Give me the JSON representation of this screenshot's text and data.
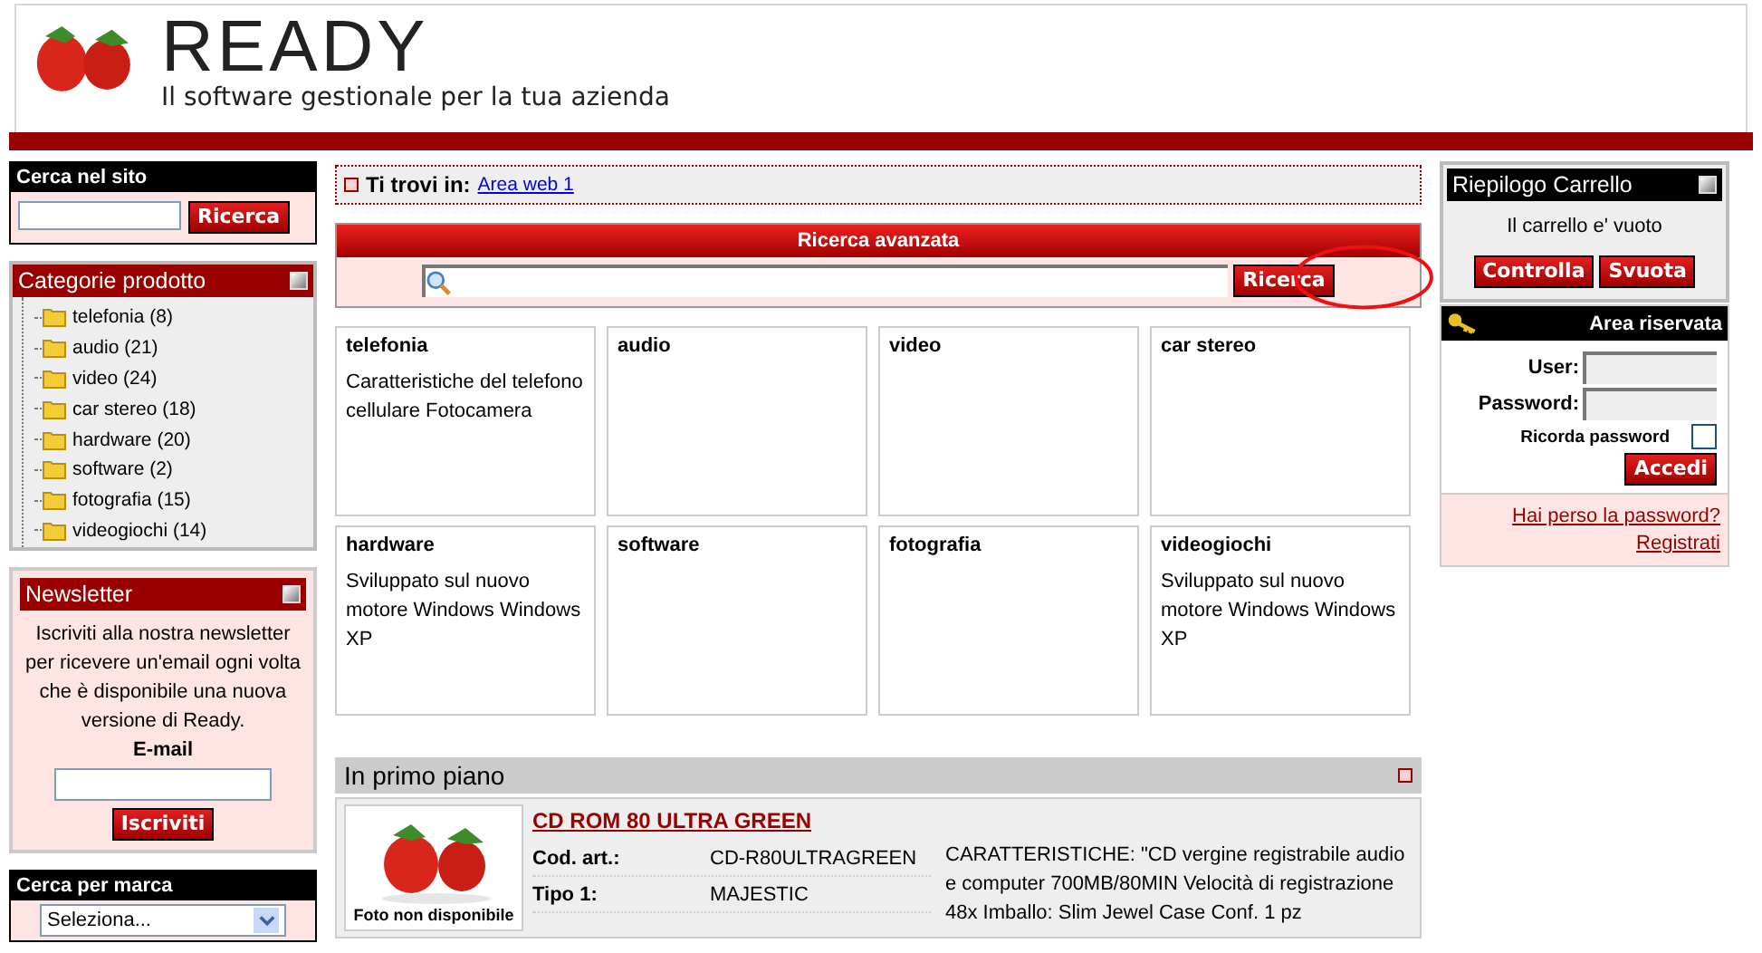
{
  "header": {
    "logo_text": "READY",
    "tagline": "Il software gestionale per la tua azienda"
  },
  "site_search": {
    "title": "Cerca nel sito",
    "button": "Ricerca"
  },
  "categories": {
    "title": "Categorie prodotto",
    "items": [
      {
        "label": "telefonia (8)"
      },
      {
        "label": "audio (21)"
      },
      {
        "label": "video (24)"
      },
      {
        "label": "car stereo (18)"
      },
      {
        "label": "hardware (20)"
      },
      {
        "label": "software (2)"
      },
      {
        "label": "fotografia (15)"
      },
      {
        "label": "videogiochi (14)"
      }
    ]
  },
  "newsletter": {
    "title": "Newsletter",
    "text": "Iscriviti alla nostra newsletter per ricevere un'email ogni volta che è disponibile una nuova versione di Ready.",
    "email_label": "E-mail",
    "button": "Iscriviti"
  },
  "brand_search": {
    "title": "Cerca per marca",
    "select_value": "Seleziona..."
  },
  "breadcrumb": {
    "label": "Ti trovi in:",
    "link": "Area web 1"
  },
  "advanced_search": {
    "title": "Ricerca avanzata",
    "button": "Ricerca"
  },
  "category_cards": [
    {
      "title": "telefonia",
      "description": "Caratteristiche del telefono cellulare Fotocamera"
    },
    {
      "title": "audio"
    },
    {
      "title": "video"
    },
    {
      "title": "car stereo"
    },
    {
      "title": "hardware",
      "description": "Sviluppato sul nuovo motore Windows Windows XP"
    },
    {
      "title": "software"
    },
    {
      "title": "fotografia"
    },
    {
      "title": "videogiochi",
      "description": "Sviluppato sul nuovo motore Windows Windows XP"
    }
  ],
  "featured": {
    "title": "In primo piano",
    "product": {
      "name": "CD ROM 80 ULTRA GREEN",
      "photo_caption": "Foto non disponibile",
      "fields": [
        {
          "label": "Cod. art.:",
          "value": "CD-R80ULTRAGREEN"
        },
        {
          "label": "Tipo 1:",
          "value": "MAJESTIC"
        }
      ],
      "description": "CARATTERISTICHE: \"CD vergine registrabile audio e computer 700MB/80MIN Velocità di registrazione 48x Imballo: Slim Jewel Case Conf. 1 pz"
    }
  },
  "cart": {
    "title": "Riepilogo Carrello",
    "message": "Il carrello e' vuoto",
    "buttons": [
      "Controlla",
      "Svuota"
    ]
  },
  "reserved_area": {
    "title": "Area riservata",
    "user_label": "User:",
    "password_label": "Password:",
    "remember_label": "Ricorda password",
    "remember_checked": false,
    "button": "Accedi",
    "links": [
      "Hai perso la password?",
      "Registrati"
    ]
  }
}
